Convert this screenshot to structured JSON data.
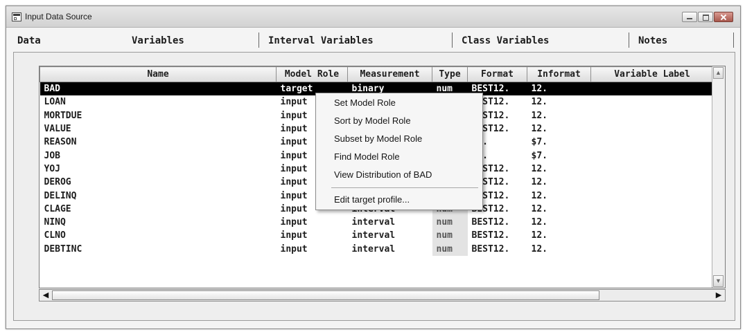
{
  "window": {
    "title": "Input Data Source"
  },
  "tabs": [
    "Data",
    "Variables",
    "Interval Variables",
    "Class Variables",
    "Notes"
  ],
  "columns": [
    "Name",
    "Model Role",
    "Measurement",
    "Type",
    "Format",
    "Informat",
    "Variable Label"
  ],
  "rows": [
    [
      "BAD",
      "target",
      "binary",
      "num",
      "BEST12.",
      "12.",
      ""
    ],
    [
      "LOAN",
      "input",
      "",
      "",
      "BEST12.",
      "12.",
      ""
    ],
    [
      "MORTDUE",
      "input",
      "",
      "",
      "BEST12.",
      "12.",
      ""
    ],
    [
      "VALUE",
      "input",
      "",
      "",
      "BEST12.",
      "12.",
      ""
    ],
    [
      "REASON",
      "input",
      "",
      "",
      "$7.",
      "$7.",
      ""
    ],
    [
      "JOB",
      "input",
      "",
      "",
      "$7.",
      "$7.",
      ""
    ],
    [
      "YOJ",
      "input",
      "",
      "",
      "BEST12.",
      "12.",
      ""
    ],
    [
      "DEROG",
      "input",
      "",
      "",
      "BEST12.",
      "12.",
      ""
    ],
    [
      "DELINQ",
      "input",
      "interval",
      "num",
      "BEST12.",
      "12.",
      ""
    ],
    [
      "CLAGE",
      "input",
      "interval",
      "num",
      "BEST12.",
      "12.",
      ""
    ],
    [
      "NINQ",
      "input",
      "interval",
      "num",
      "BEST12.",
      "12.",
      ""
    ],
    [
      "CLNO",
      "input",
      "interval",
      "num",
      "BEST12.",
      "12.",
      ""
    ],
    [
      "DEBTINC",
      "input",
      "interval",
      "num",
      "BEST12.",
      "12.",
      ""
    ]
  ],
  "context_menu": {
    "items": [
      "Set Model Role",
      "Sort by Model Role",
      "Subset by Model Role",
      "Find Model Role",
      "View Distribution of BAD"
    ],
    "footer_item": "Edit target profile..."
  },
  "icons": [
    "app-icon",
    "minimize-icon",
    "maximize-icon",
    "close-icon",
    "scroll-up-icon",
    "scroll-down-icon",
    "scroll-left-icon",
    "scroll-right-icon"
  ],
  "colors": {
    "selected_row_bg": "#000000",
    "selected_row_fg": "#ffffff",
    "close_button": "#b5675c"
  }
}
